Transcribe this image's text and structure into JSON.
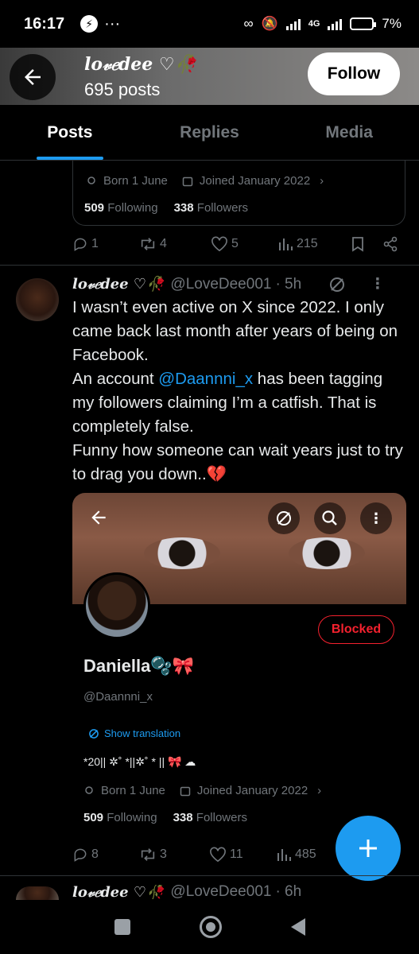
{
  "status_bar": {
    "time": "16:17",
    "left_icons": [
      "messenger-icon",
      "more-dots-icon"
    ],
    "network": "4G",
    "battery": "7%"
  },
  "header": {
    "name": "lo𝓋𝑒dee ♡🥀",
    "posts": "695 posts",
    "follow_label": "Follow"
  },
  "tabs": [
    {
      "label": "Posts",
      "active": true
    },
    {
      "label": "Replies",
      "active": false
    },
    {
      "label": "Media",
      "active": false
    }
  ],
  "quoted_card_top": {
    "born": "Born 1 June",
    "joined": "Joined January 2022",
    "following_count": "509",
    "following_label": "Following",
    "followers_count": "338",
    "followers_label": "Followers"
  },
  "top_actions": {
    "replies": "1",
    "reposts": "4",
    "likes": "5",
    "views": "215"
  },
  "tweet": {
    "name": "lo𝓋𝑒dee ♡🥀",
    "handle": "@LoveDee001",
    "time": "· 5h",
    "line1": "I wasn’t even active on X since 2022. I only came back last month after years of being on Facebook.",
    "line2_pre": "An account ",
    "mention": "@Daannni_x",
    "line2_post": " has been tagging my followers claiming I’m a catfish. That is completely false.",
    "line3": "Funny how someone can wait years just to try to drag you down..💔"
  },
  "screenshot": {
    "blocked_label": "Blocked",
    "name": "Daniella🫧🎀",
    "handle": "@Daannni_x",
    "translate": "Show translation",
    "bio": "*20|| ✲˚ *||✲˚ * || 🎀 ☁",
    "born": "Born 1 June",
    "joined": "Joined January 2022",
    "following_count": "509",
    "following_label": "Following",
    "followers_count": "338",
    "followers_label": "Followers"
  },
  "bottom_actions": {
    "replies": "8",
    "reposts": "3",
    "likes": "11",
    "views": "485"
  },
  "next_tweet": {
    "name": "lo𝓋𝑒dee ♡🥀",
    "handle": "@LoveDee001",
    "time": "· 6h"
  },
  "colors": {
    "accent": "#1d9bf0",
    "blocked": "#f4212e",
    "muted": "#71767b",
    "background": "#000000"
  }
}
